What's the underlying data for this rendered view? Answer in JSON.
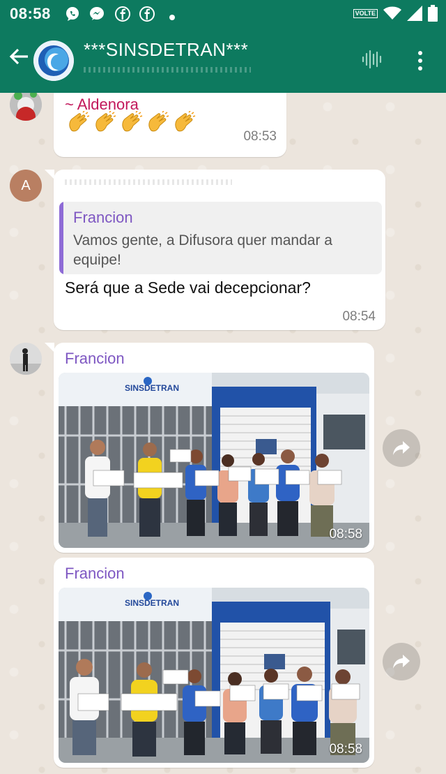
{
  "status": {
    "time": "08:58",
    "volte": "VOLTE"
  },
  "header": {
    "title": "***SINSDETRAN***"
  },
  "messages": [
    {
      "sender": "~ Aldenora",
      "emoji": "👏👏👏👏👏",
      "time": "08:53"
    },
    {
      "avatar_letter": "A",
      "quote_sender": "Francion",
      "quote_text": "Vamos gente, a Difusora quer mandar a equipe!",
      "text": "Será que a Sede vai decepcionar?",
      "time": "08:54"
    },
    {
      "sender": "Francion",
      "photo_sign": "SINSDETRAN",
      "time": "08:58"
    },
    {
      "sender": "Francion",
      "photo_sign": "SINSDETRAN",
      "time": "08:58"
    }
  ],
  "colors": {
    "header": "#0d7a5f",
    "aldenora": "#c2185b",
    "francion": "#7e57c2",
    "chat_bg": "#ece5dd"
  }
}
